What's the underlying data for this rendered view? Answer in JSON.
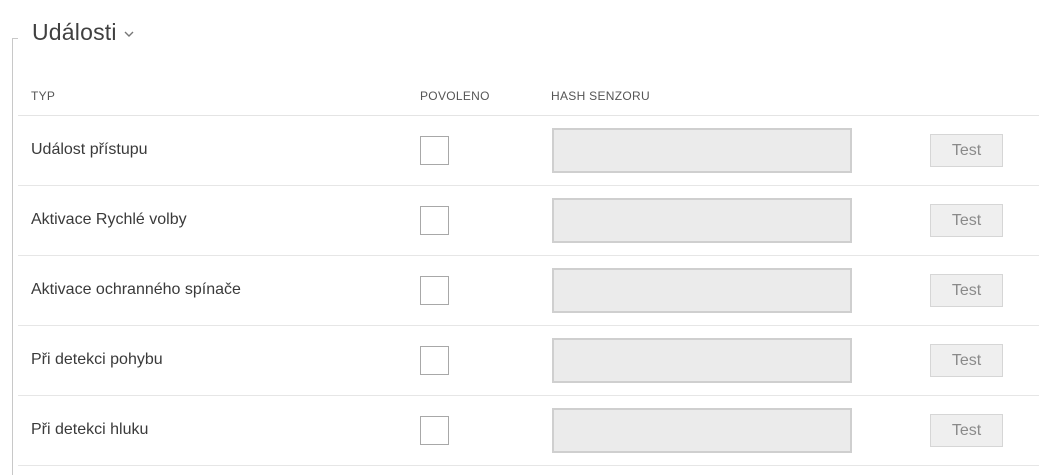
{
  "section": {
    "title": "Události",
    "chevron_icon": "chevron-down-icon"
  },
  "table": {
    "headers": {
      "type": "TYP",
      "enabled": "POVOLENO",
      "hash": "HASH SENZORU"
    },
    "rows": [
      {
        "label": "Událost přístupu",
        "enabled": false,
        "hash": "",
        "button": "Test"
      },
      {
        "label": "Aktivace Rychlé volby",
        "enabled": false,
        "hash": "",
        "button": "Test"
      },
      {
        "label": "Aktivace ochranného spínače",
        "enabled": false,
        "hash": "",
        "button": "Test"
      },
      {
        "label": "Při detekci pohybu",
        "enabled": false,
        "hash": "",
        "button": "Test"
      },
      {
        "label": "Při detekci hluku",
        "enabled": false,
        "hash": "",
        "button": "Test"
      }
    ]
  }
}
